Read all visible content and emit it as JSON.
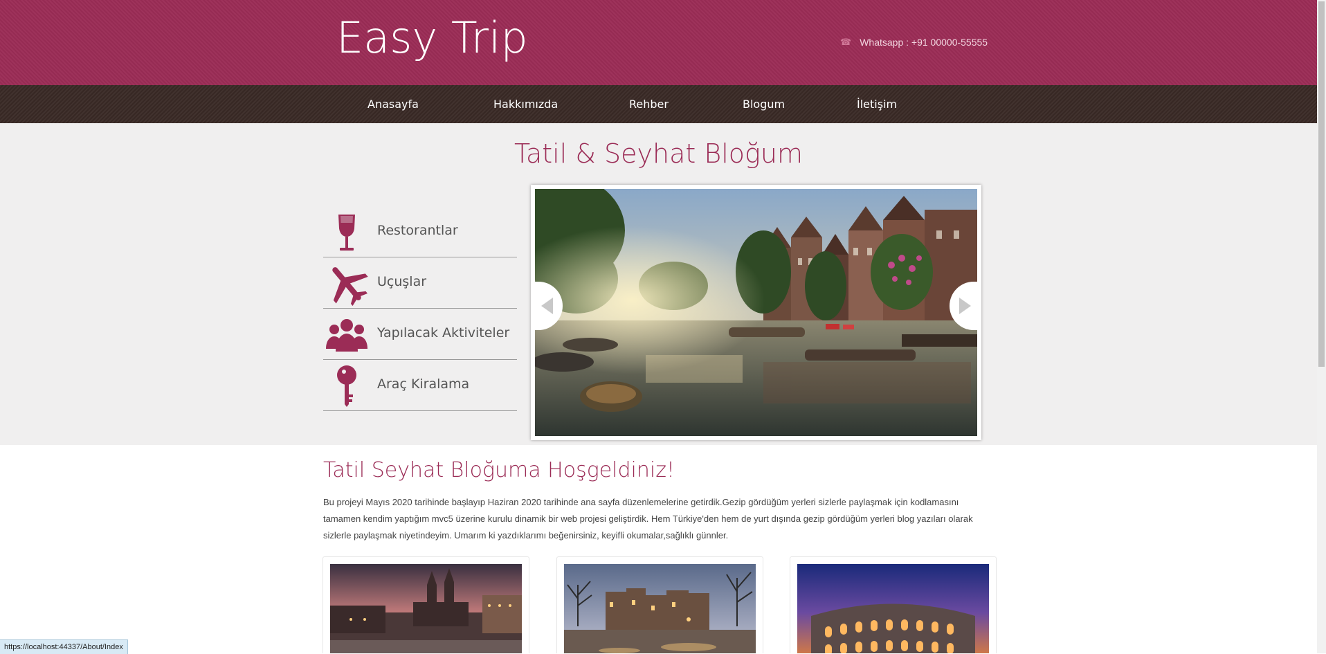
{
  "header": {
    "logo": "Easy Trip",
    "phone_icon": "phone-icon",
    "contact": "Whatsapp : +91 00000-55555"
  },
  "nav": {
    "items": [
      "Anasayfa",
      "Hakkımızda",
      "Rehber",
      "Blogum",
      "İletişim"
    ]
  },
  "banner": {
    "title": "Tatil & Seyhat Bloğum",
    "categories": [
      {
        "label": "Restorantlar",
        "icon": "wine-glass-icon"
      },
      {
        "label": "Uçuşlar",
        "icon": "airplane-icon"
      },
      {
        "label": "Yapılacak Aktiviteler",
        "icon": "people-group-icon"
      },
      {
        "label": "Araç Kiralama",
        "icon": "key-icon"
      }
    ],
    "slider": {
      "prev_icon": "chevron-left-icon",
      "next_icon": "chevron-right-icon"
    }
  },
  "welcome": {
    "title": "Tatil Seyhat Bloğuma Hoşgeldiniz!",
    "text": "Bu projeyi Mayıs 2020 tarihinde başlayıp Haziran 2020 tarihinde ana sayfa düzenlemelerine getirdik.Gezip gördüğüm yerleri sizlerle paylaşmak için kodlamasını tamamen kendim yaptığım mvc5 üzerine kurulu dinamik bir web projesi geliştirdik. Hem Türkiye'den hem de yurt dışında gezip gördüğüm yerleri blog yazıları olarak sizlerle paylaşmak niyetindeyim. Umarım ki yazdıklarımı beğenirsiniz, keyifli okumalar,sağlıklı günnler."
  },
  "colors": {
    "brand": "#9b2c56",
    "nav_bg": "#3a2a26",
    "banner_bg": "#f0efef"
  },
  "statusbar": {
    "url": "https://localhost:44337/About/Index"
  }
}
